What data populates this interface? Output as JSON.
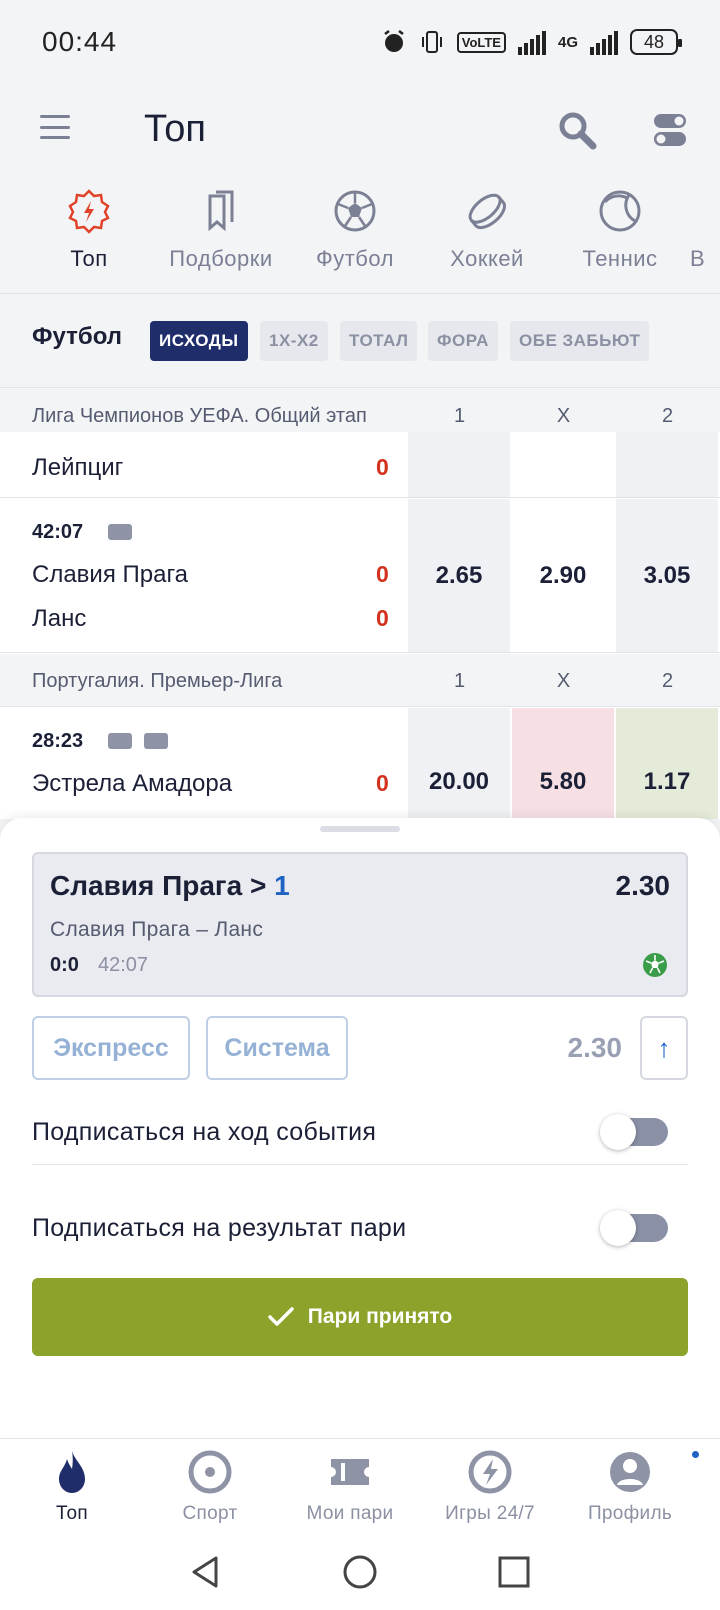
{
  "status_bar": {
    "time": "00:44",
    "volte": "VoLTE",
    "network": "4G",
    "battery": "48"
  },
  "header": {
    "title": "Топ"
  },
  "sport_tabs": [
    {
      "label": "Топ",
      "icon": "lightning-badge-icon",
      "active": true
    },
    {
      "label": "Подборки",
      "icon": "bookmarks-icon",
      "active": false
    },
    {
      "label": "Футбол",
      "icon": "soccer-ball-icon",
      "active": false
    },
    {
      "label": "Хоккей",
      "icon": "hockey-puck-icon",
      "active": false
    },
    {
      "label": "Теннис",
      "icon": "tennis-ball-icon",
      "active": false
    },
    {
      "label": "В",
      "icon": "",
      "active": false
    }
  ],
  "market_bar": {
    "title": "Футбол",
    "chips": [
      "ИСХОДЫ",
      "1Х-Х2",
      "ТОТАЛ",
      "ФОРА",
      "ОБЕ ЗАБЬЮТ"
    ],
    "active_chip": "ИСХОДЫ"
  },
  "leagues": [
    {
      "name": "Лига Чемпионов УЕФА. Общий этап",
      "columns": [
        "1",
        "X",
        "2"
      ]
    },
    {
      "name": "Португалия. Премьер-Лига",
      "columns": [
        "1",
        "X",
        "2"
      ]
    }
  ],
  "matches": [
    {
      "time": "",
      "team1": "Лейпциг",
      "score1": "0",
      "team2": "",
      "score2": "",
      "odds": [
        "",
        "",
        ""
      ]
    },
    {
      "time": "42:07",
      "team1": "Славия Прага",
      "score1": "0",
      "team2": "Ланс",
      "score2": "0",
      "odds": [
        "2.65",
        "2.90",
        "3.05"
      ]
    },
    {
      "time": "28:23",
      "team1": "Эстрела Амадора",
      "score1": "0",
      "team2": "",
      "score2": "",
      "odds": [
        "20.00",
        "5.80",
        "1.17"
      ]
    }
  ],
  "bet_slip": {
    "selection_team": "Славия Прага",
    "selection_separator": ">",
    "selection_outcome": "1",
    "coefficient": "2.30",
    "match": "Славия Прага – Ланс",
    "score": "0:0",
    "time": "42:07",
    "express_label": "Экспресс",
    "system_label": "Система",
    "total_coefficient": "2.30",
    "subscribe_event_label": "Подписаться на ход события",
    "subscribe_result_label": "Подписаться на результат пари",
    "accept_label": "Пари принято",
    "colors": {
      "accept": "#8ba22b",
      "outcome": "#1e63c4",
      "score": "#d2321e"
    }
  },
  "bottom_nav": [
    {
      "label": "Топ",
      "icon": "flame-icon",
      "active": true
    },
    {
      "label": "Спорт",
      "icon": "target-icon",
      "active": false
    },
    {
      "label": "Мои пари",
      "icon": "ticket-icon",
      "active": false
    },
    {
      "label": "Игры 24/7",
      "icon": "lightning-circle-icon",
      "active": false
    },
    {
      "label": "Профиль",
      "icon": "user-icon",
      "active": false
    }
  ]
}
